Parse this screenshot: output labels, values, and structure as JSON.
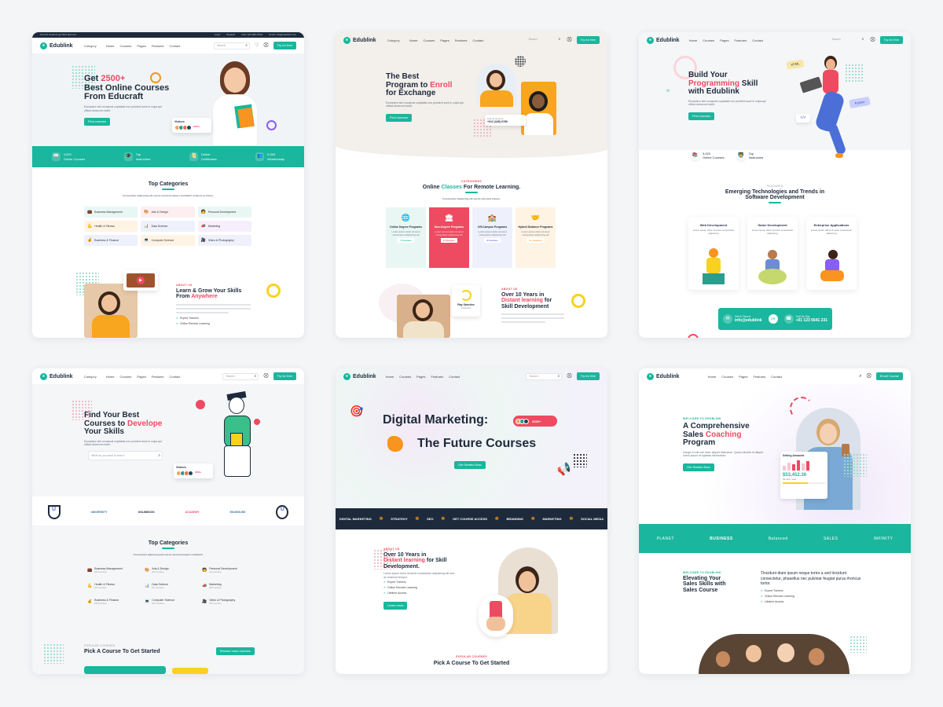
{
  "colors": {
    "accent": "#1ab69d",
    "pink": "#ee4a62",
    "navy": "#1d2a3b",
    "orange": "#f8941f"
  },
  "common": {
    "logo": "Edublink",
    "category": "Category",
    "menu": [
      "Home",
      "Courses",
      "Pages",
      "Features",
      "Contact"
    ],
    "search": "Search",
    "cta": "Try for free"
  },
  "card1": {
    "topbar_left": "First 20 students get 50% discount.",
    "topbar_right": [
      "Login",
      "Register",
      "Call: 123 4561 5523",
      "Email: info@edublink.com"
    ],
    "hero_pre": "Get",
    "hero_num": "2500+",
    "hero_line2": "Best Online Courses",
    "hero_line3": "From Educraft",
    "hero_desc": "Excepteur sint occaecat cupidatat non proident sunt in culpa qui officia deserunt mollit.",
    "btn": "Find courses",
    "visitors_title": "Visitors",
    "visitors_count": "2000+",
    "visitors_sub": "Visitors",
    "stats": [
      {
        "icon": "📖",
        "num": "3,020",
        "label": "Online Courses"
      },
      {
        "icon": "🎓",
        "num": "Top",
        "label": "Instructors"
      },
      {
        "icon": "📜",
        "num": "Online",
        "label": "Certificates"
      },
      {
        "icon": "👥",
        "num": "6,000",
        "label": "Membership"
      }
    ],
    "cat_title": "Top Categories",
    "cat_desc": "Consectetur adipiscing elit sed do eiusmod tempor incididunt ut labore et dolore.",
    "categories": [
      "Business Management",
      "Arts & Design",
      "Personal Development",
      "Health & Fitness",
      "Data Science",
      "Marketing",
      "Business & Finance",
      "Computer Science",
      "Video & Photography"
    ],
    "about_sub": "ABOUT US",
    "about_title1": "Learn & Grow Your Skills",
    "about_title2": "From",
    "about_hl": "Anywhere",
    "about_list": [
      "Expert Trainers",
      "Online Remote Learning"
    ]
  },
  "card2": {
    "h1": "The Best",
    "h2a": "Program to",
    "h2b": "Enroll",
    "h3": "for Exchange",
    "desc": "Excepteur sint occaecat cupidatat non proident sunt in culpa qui officia deserunt mollit.",
    "btn": "Find courses",
    "call_label": "Call us anytime",
    "call": "+012 (345) 6789",
    "sec_sub": "CATEGORIES",
    "sec_title_a": "Online",
    "sec_title_hl": "Classes",
    "sec_title_b": "For Remote Learning.",
    "sec_desc": "Consectetur adipiscing elit sed do eiusmod tempor.",
    "programs": [
      {
        "icon": "🌐",
        "label": "Online Degree Programs",
        "count": "7 Courses"
      },
      {
        "icon": "🏛",
        "label": "Non-Degree Programs",
        "count": "6 Courses"
      },
      {
        "icon": "🏫",
        "label": "Off-Campus Programs",
        "count": "3 Courses"
      },
      {
        "icon": "🤝",
        "label": "Hybrid Distance Programs",
        "count": "4+ Courses"
      }
    ],
    "prog_desc": "Lorem ipsum dolor sit amet consectetur adipiscing elit",
    "about_sub": "ABOUT US",
    "about_t1": "Over 10 Years in",
    "about_hl": "Distant learning",
    "about_t2": "for",
    "about_t3": "Skill Development",
    "tag_name": "Ray Sanchez",
    "tag_role": "Instructor"
  },
  "card3": {
    "h1": "Build Your",
    "h2hl": "Programming",
    "h2b": "Skill",
    "h3": "with Edublink",
    "desc": "Excepteur sint occaecat cupidatat non proident sunt in culpa qui officia deserunt mollit.",
    "btn": "Find courses",
    "html_tag": "HTML",
    "python_tag": "Python",
    "code_tag": "</>",
    "stats": [
      {
        "num": "3,020",
        "label": "Online Courses"
      },
      {
        "num": "Top",
        "label": "Instructors"
      }
    ],
    "sec_sub": "FEATURES",
    "sec_title1": "Emerging Technologies and Trends in",
    "sec_title2": "Software Development",
    "techs": [
      {
        "title": "Web Development",
        "desc": "Lorem ipsum dolor sit amet consectetur adipiscing"
      },
      {
        "title": "Game Development",
        "desc": "Lorem ipsum dolor sit amet consectetur adipiscing"
      },
      {
        "title": "Enterprise Applications",
        "desc": "Lorem ipsum dolor sit amet consectetur adipiscing"
      }
    ],
    "touch_label": "Get In Touch:",
    "touch_val": "info@edublink",
    "call_label": "Call Us Via:",
    "call_val": "+01 123 5641 231"
  },
  "card4": {
    "h1": "Find Your Best",
    "h2a": "Courses to",
    "h2hl": "Develope",
    "h3": "Your Skills",
    "desc": "Excepteur sint occaecat cupidatat non proident sunt in culpa qui officia deserunt mollit.",
    "search_ph": "What do you want to learn?",
    "visitors_title": "Visitors",
    "visitors_count": "2000+",
    "logos": [
      "U",
      "UNIVERSITY",
      "ONLINBOOK",
      "ACADEMY",
      "EDUHOUSE",
      "U"
    ],
    "cat_title": "Top Categories",
    "cat_desc": "Consectetur adipiscing elit sed do eiusmod tempor incididunt.",
    "categories": [
      {
        "name": "Business Management",
        "count": "08 Courses"
      },
      {
        "name": "Arts & Design",
        "count": "05 Courses"
      },
      {
        "name": "Personal Development",
        "count": "12 Courses"
      },
      {
        "name": "Health & Fitness",
        "count": "06 Courses"
      },
      {
        "name": "Data Science",
        "count": "04 Courses"
      },
      {
        "name": "Marketing",
        "count": "08 Courses"
      },
      {
        "name": "Business & Finance",
        "count": "08 Courses"
      },
      {
        "name": "Computer Science",
        "count": "05 Courses"
      },
      {
        "name": "Video & Photography",
        "count": "06 Courses"
      }
    ],
    "pop_sub": "POPULAR COURSES",
    "pop_title": "Pick A Course To Get Started",
    "pop_btn": "Browse more courses"
  },
  "card5": {
    "h1": "Digital Marketing:",
    "h2": "The Future Courses",
    "badge": "2000+",
    "badge_sub": "Students",
    "btn": "Get Started Now",
    "ticker": [
      "DIGITAL MARKETING",
      "STRATEGY",
      "SEO",
      "GET COURSE ACCESS",
      "BRANDING",
      "MARKETING",
      "SOCIAL MEDIA"
    ],
    "about_sub": "ABOUT US",
    "about_t1": "Over 10 Years in",
    "about_hl": "Distant learning",
    "about_t2": "for Skill",
    "about_t3": "Development.",
    "about_desc": "Lorem ipsum dolor sit amet consectetur adipiscing elit sed do eiusmod tempor.",
    "about_list": [
      "Expert Trainers",
      "Online Remote Learning",
      "Lifetime Access"
    ],
    "about_btn": "Learn more",
    "pop_sub": "POPULAR COURSES",
    "pop_title": "Pick A Course To Get Started"
  },
  "card6": {
    "cta": "Enroll Course",
    "sub": "WELCOME TO EDUBLINK",
    "h1": "A Comprehensive",
    "h2a": "Sales",
    "h2hl": "Coaching",
    "h3": "Program",
    "desc": "Integer et elit sed dolor aliquet bibendum. Quam lobortis et aliquet lorem ipsum et egestas elementum.",
    "btn": "Get Started Now",
    "selling_title": "Selling Amounts",
    "sales_value": "$53,452.36",
    "sales_sub": "Monthly Sale",
    "logos": [
      "PLANET",
      "BUSINESS",
      "Balanced",
      "SALES",
      "INFINITY"
    ],
    "sec_sub": "WELCOME TO EDUBLINK",
    "sec_t1": "Elevating Your",
    "sec_t2": "Sales Skills with",
    "sec_t3": "Sales Course",
    "right_t": "Tincidunt diam ipsum neque tortor a sed tincidunt consectetur, phasellus nec pulvinar feugiat purus rhoncus tortor.",
    "list": [
      "Expert Trainers",
      "Online Remote Learning",
      "Lifetime Access"
    ]
  }
}
